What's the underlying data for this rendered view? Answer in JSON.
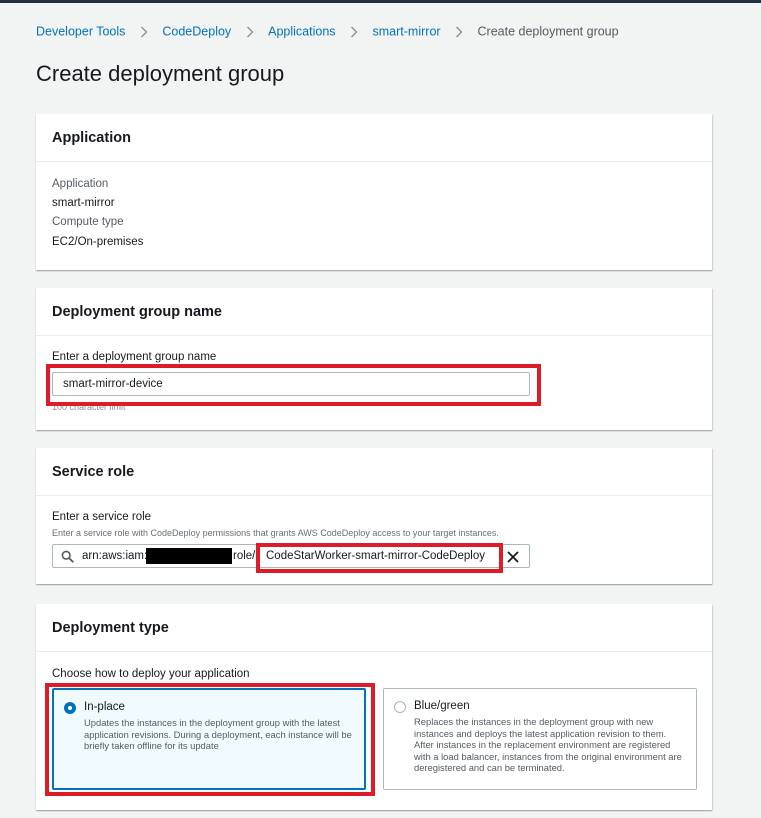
{
  "breadcrumb": {
    "items": [
      "Developer Tools",
      "CodeDeploy",
      "Applications",
      "smart-mirror",
      "Create deployment group"
    ]
  },
  "page": {
    "title": "Create deployment group"
  },
  "application_card": {
    "title": "Application",
    "application_label": "Application",
    "application_value": "smart-mirror",
    "compute_label": "Compute type",
    "compute_value": "EC2/On-premises"
  },
  "group_name_card": {
    "title": "Deployment group name",
    "field_label": "Enter a deployment group name",
    "field_value": "smart-mirror-device",
    "hint": "100 character limit"
  },
  "service_role_card": {
    "title": "Service role",
    "field_label": "Enter a service role",
    "field_description": "Enter a service role with CodeDeploy permissions that grants AWS CodeDeploy access to your target instances.",
    "arn_prefix": "arn:aws:iam:",
    "arn_role_segment": "role/",
    "role_name": "CodeStarWorker-smart-mirror-CodeDeploy"
  },
  "deployment_type_card": {
    "title": "Deployment type",
    "prompt": "Choose how to deploy your application",
    "options": [
      {
        "title": "In-place",
        "description": "Updates the instances in the deployment group with the latest application revisions. During a deployment, each instance will be briefly taken offline for its update",
        "selected": true
      },
      {
        "title": "Blue/green",
        "description": "Replaces the instances in the deployment group with new instances and deploys the latest application revision to them. After instances in the replacement environment are registered with a load balancer, instances from the original environment are deregistered and can be terminated.",
        "selected": false
      }
    ]
  },
  "colors": {
    "link": "#0073bb",
    "selected_border": "#0073bb",
    "selected_background": "#f1faff",
    "highlight_annotation": "#dd1c2a",
    "page_background": "#f2f3f3"
  },
  "icons": {
    "separator": "chevron-right-icon",
    "search": "search-icon",
    "clear": "close-icon"
  }
}
